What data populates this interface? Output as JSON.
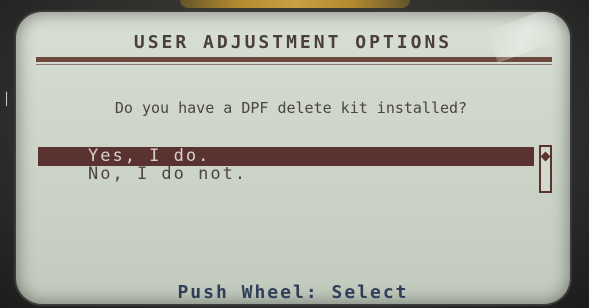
{
  "screen": {
    "title": "USER ADJUSTMENT OPTIONS",
    "question": "Do you have a DPF delete kit installed?",
    "options": [
      {
        "label": "Yes, I do.",
        "selected": true
      },
      {
        "label": "No, I do not.",
        "selected": false
      }
    ],
    "footer": "Push Wheel: Select",
    "scroll_icon": "diamond-scroll-indicator-icon"
  },
  "colors": {
    "lcd_background": "#cfd6ca",
    "selection_bar": "#5a3330",
    "title_text": "#4a3f3c",
    "footer_text": "#2f3f5a"
  }
}
